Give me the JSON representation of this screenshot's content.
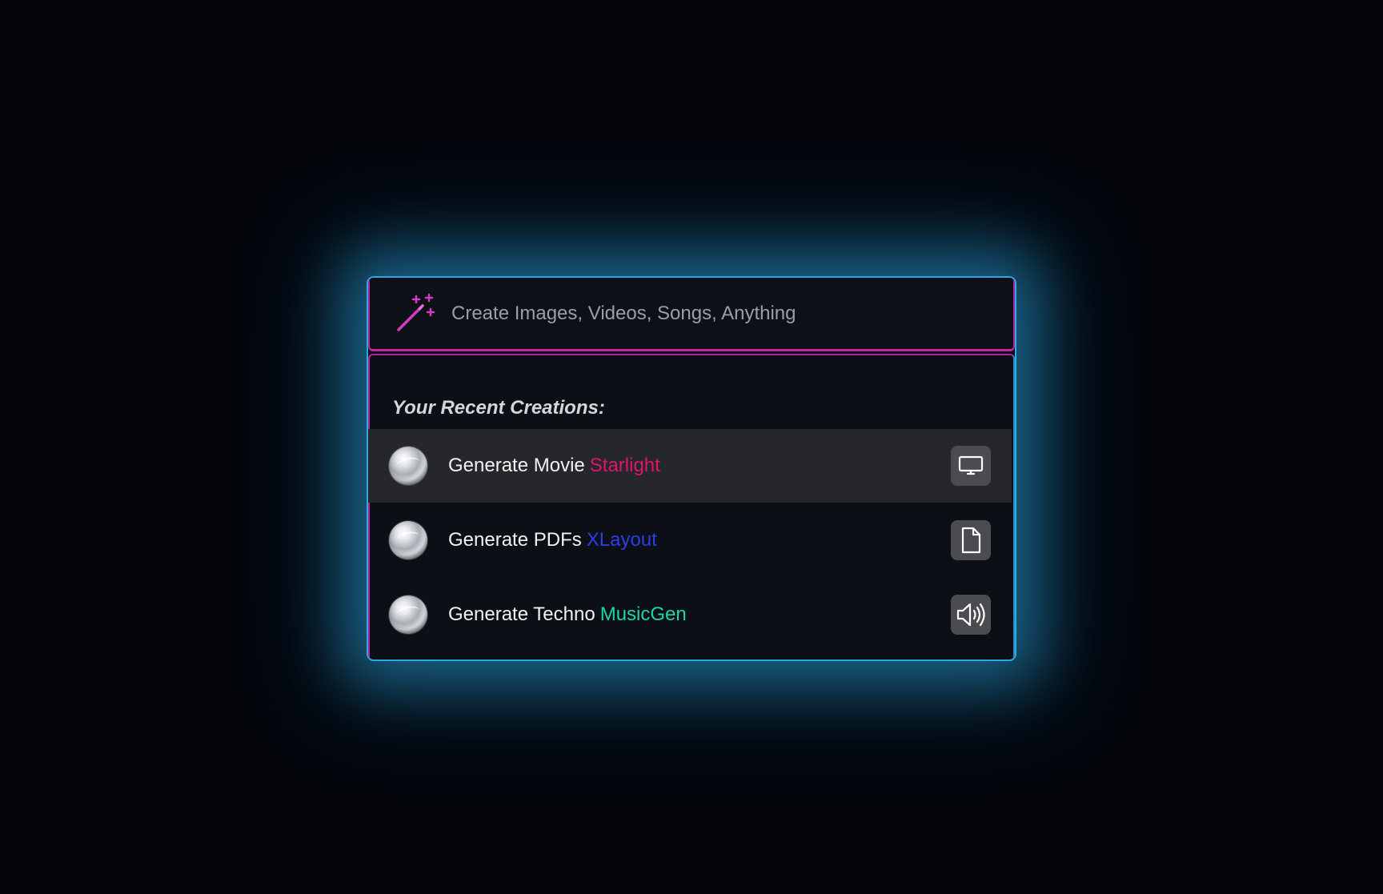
{
  "search": {
    "placeholder": "Create Images, Videos, Songs, Anything",
    "icon": "magic-wand-icon"
  },
  "recent": {
    "title": "Your Recent Creations:",
    "items": [
      {
        "prefix": "Generate Movie",
        "name": "Starlight",
        "accent_color": "#e0146c",
        "action_icon": "monitor-icon",
        "active": true
      },
      {
        "prefix": "Generate PDFs",
        "name": "XLayout",
        "accent_color": "#2b3ee8",
        "action_icon": "file-icon",
        "active": false
      },
      {
        "prefix": "Generate Techno",
        "name": "MusicGen",
        "accent_color": "#1ed6a0",
        "action_icon": "speaker-icon",
        "active": false
      }
    ]
  },
  "colors": {
    "glow": "#2fa6e6",
    "magenta": "#c0269f",
    "panel_bg": "#0c0f15",
    "background": "#03050a"
  }
}
